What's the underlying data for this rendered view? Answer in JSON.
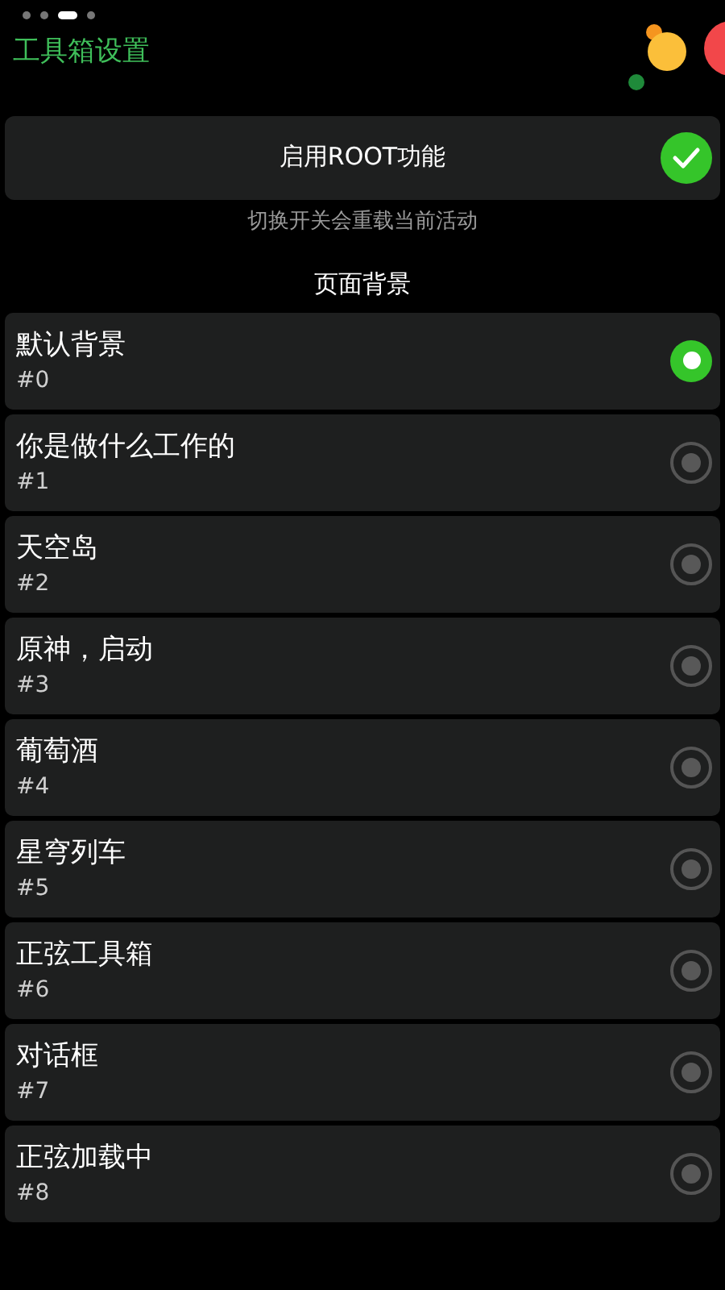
{
  "pager": [
    {
      "selected": false
    },
    {
      "selected": false
    },
    {
      "selected": true
    },
    {
      "selected": false
    }
  ],
  "title": "工具箱设置",
  "root_toggle": {
    "label": "启用ROOT功能",
    "checked": true
  },
  "root_hint": "切换开关会重载当前活动",
  "section_title": "页面背景",
  "backgrounds": [
    {
      "name": "默认背景",
      "index": "#0",
      "selected": true
    },
    {
      "name": "你是做什么工作的",
      "index": "#1",
      "selected": false
    },
    {
      "name": "天空岛",
      "index": "#2",
      "selected": false
    },
    {
      "name": "原神，启动",
      "index": "#3",
      "selected": false
    },
    {
      "name": "葡萄酒",
      "index": "#4",
      "selected": false
    },
    {
      "name": "星穹列车",
      "index": "#5",
      "selected": false
    },
    {
      "name": "正弦工具箱",
      "index": "#6",
      "selected": false
    },
    {
      "name": "对话框",
      "index": "#7",
      "selected": false
    },
    {
      "name": "正弦加载中",
      "index": "#8",
      "selected": false
    }
  ]
}
